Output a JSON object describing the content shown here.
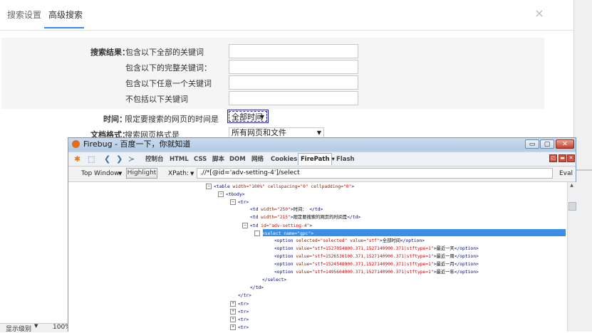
{
  "page": {
    "tabs": [
      {
        "label": "搜索设置"
      },
      {
        "label": "高级搜索"
      }
    ],
    "close_symbol": "×",
    "form": {
      "section_label": "搜索结果：",
      "rows": [
        {
          "label": "包含以下全部的关键词"
        },
        {
          "label": "包含以下的完整关键词："
        },
        {
          "label": "包含以下任意一个关键词"
        },
        {
          "label": "不包括以下关键词"
        }
      ],
      "time": {
        "label_bold": "时间：",
        "label": "限定要搜索的网页的时间是",
        "value": "全部时间"
      },
      "format": {
        "label_bold": "文档格式：",
        "label": "搜索网页格式是",
        "value": "所有网页和文件"
      }
    },
    "status": {
      "left": "显示级别",
      "zoom": "100%"
    }
  },
  "firebug": {
    "title": "Firebug - 百度一下，你就知道",
    "window_buttons": {
      "minimize": "▭",
      "maximize": "▢",
      "close": "✕"
    },
    "panel_tabs": [
      "控制台",
      "HTML",
      "CSS",
      "脚本",
      "DOM",
      "网络",
      "Cookies",
      "FirePath ▾",
      "Flash"
    ],
    "toolbar": {
      "top_window": "Top Window",
      "highlight": "Highlight",
      "xpath_label": "XPath:",
      "xpath_value": ".//*[@id='adv-setting-4']/select",
      "eval": "Eval"
    },
    "code_lines": [
      {
        "indent": 0,
        "toggle": "⊟",
        "html": "<table width=\"100%\" cellspacing=\"0\" cellpadding=\"0\">"
      },
      {
        "indent": 1,
        "toggle": "⊟",
        "html": "<tbody>"
      },
      {
        "indent": 2,
        "toggle": "⊟",
        "html": "<tr>"
      },
      {
        "indent": 3,
        "toggle": "",
        "html": "<td width=\"250\">时间： </td>"
      },
      {
        "indent": 3,
        "toggle": "",
        "html": "<td width=\"215\">限定要搜索的网页的时间是</td>"
      },
      {
        "indent": 3,
        "toggle": "⊟",
        "html": "<td id=\"adv-setting-4\">"
      },
      {
        "indent": 4,
        "toggle": "⊟",
        "html": "<select name=\"gpc\">",
        "selected": true
      },
      {
        "indent": 5,
        "toggle": "",
        "html": "<option selected=\"selected\" value=\"stf\">全部时间</option>"
      },
      {
        "indent": 5,
        "toggle": "",
        "html": "<option value=\"stf=1527054800.371,1527140900.371|stftype=1\">最近一天</option>"
      },
      {
        "indent": 5,
        "toggle": "",
        "html": "<option value=\"stf=1526536100.371,1527140900.371|stftype=1\">最近一周</option>"
      },
      {
        "indent": 5,
        "toggle": "",
        "html": "<option value=\"stf=1524548900.371,1527140900.371|stftype=1\">最近一月</option>"
      },
      {
        "indent": 5,
        "toggle": "",
        "html": "<option value=\"stf=1495604900.371,1527140900.371|stftype=1\">最近一年</option>"
      },
      {
        "indent": 4,
        "toggle": "",
        "html": "</select>"
      },
      {
        "indent": 3,
        "toggle": "",
        "html": "</td>"
      },
      {
        "indent": 2,
        "toggle": "",
        "html": "</tr>"
      },
      {
        "indent": 2,
        "toggle": "⊞",
        "html": "<tr>"
      },
      {
        "indent": 2,
        "toggle": "⊞",
        "html": "<tr>"
      },
      {
        "indent": 2,
        "toggle": "⊞",
        "html": "<tr>"
      },
      {
        "indent": 2,
        "toggle": "⊞",
        "html": "<tr>"
      }
    ]
  }
}
